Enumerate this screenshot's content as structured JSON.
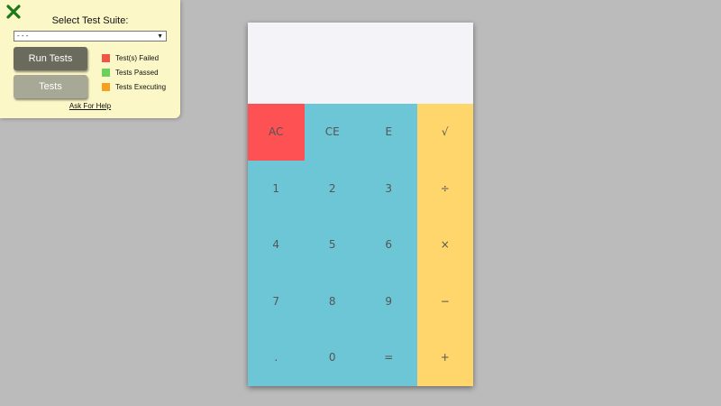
{
  "panel": {
    "title": "Select Test Suite:",
    "suite_selected": "- - -",
    "run_tests_label": "Run Tests",
    "tests_label": "Tests",
    "legend": [
      {
        "label": "Test(s) Failed",
        "color": "#f05545"
      },
      {
        "label": "Tests Passed",
        "color": "#6cd15c"
      },
      {
        "label": "Tests Executing",
        "color": "#f5a021"
      }
    ],
    "help_label": "Ask For Help",
    "close_icon": "close-x-icon",
    "close_color": "#1a7a1a"
  },
  "calculator": {
    "display_value": "",
    "keys": {
      "ac": "AC",
      "ce": "CE",
      "e": "E",
      "sqrt": "√",
      "k1": "1",
      "k2": "2",
      "k3": "3",
      "divide": "÷",
      "k4": "4",
      "k5": "5",
      "k6": "6",
      "multiply": "×",
      "k7": "7",
      "k8": "8",
      "k9": "9",
      "minus": "−",
      "dot": ".",
      "k0": "0",
      "equals": "=",
      "plus": "+"
    },
    "colors": {
      "number_keys": "#6cc6d6",
      "operator_keys": "#fed66b",
      "clear_key": "#fd5153",
      "display": "#f4f3f8"
    }
  }
}
